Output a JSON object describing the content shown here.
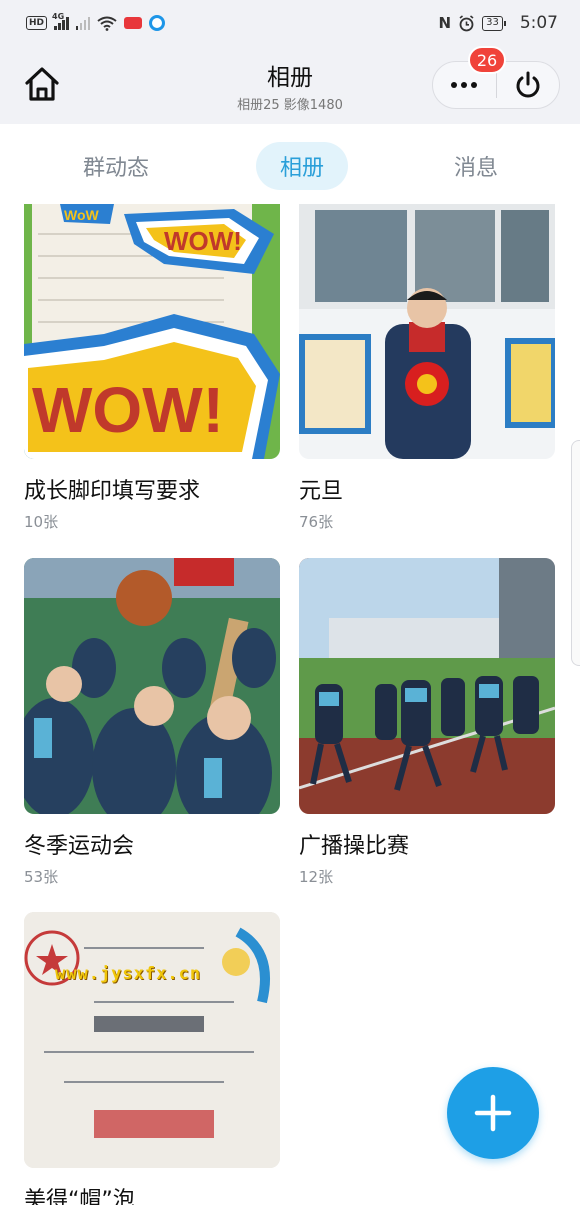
{
  "status_bar": {
    "network_tag": "4G",
    "battery": "33",
    "time": "5:07"
  },
  "header": {
    "title": "相册",
    "subtitle": "相册25 影像1480",
    "badge_count": "26"
  },
  "tabs": [
    {
      "label": "群动态",
      "active": false
    },
    {
      "label": "相册",
      "active": true
    },
    {
      "label": "消息",
      "active": false
    }
  ],
  "albums": [
    {
      "name": "成长脚印填写要求",
      "count": "10张"
    },
    {
      "name": "元旦",
      "count": "76张"
    },
    {
      "name": "冬季运动会",
      "count": "53张"
    },
    {
      "name": "广播操比赛",
      "count": "12张"
    },
    {
      "name": "美得“帽”泡",
      "count": ""
    }
  ],
  "watermark": "www.jysxfx.cn",
  "colors": {
    "accent": "#2a9fd9",
    "fab": "#1e9fe6",
    "badge": "#f0433a",
    "header_bg": "#f1f2f6"
  },
  "icons": {
    "home": "home-icon",
    "more": "more-dots-icon",
    "power": "power-icon",
    "add": "plus-icon"
  }
}
